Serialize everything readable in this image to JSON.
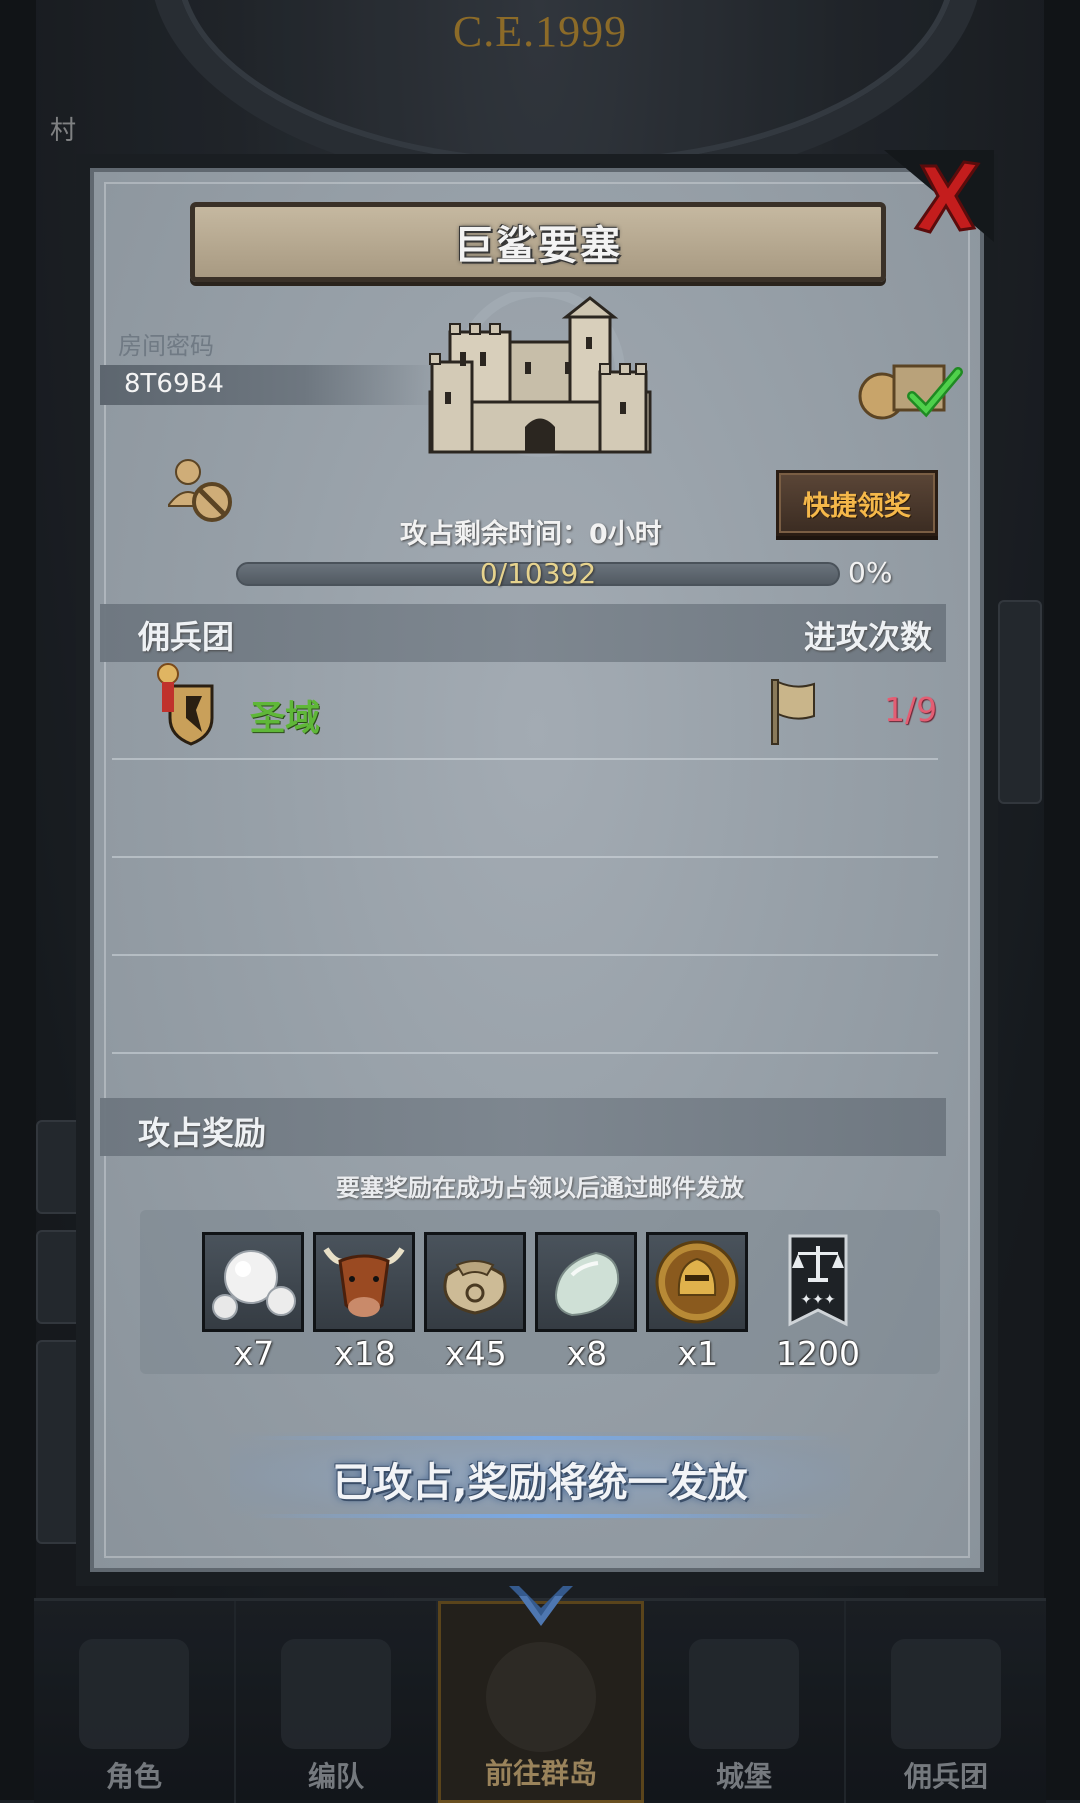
{
  "background": {
    "era_text": "C.E.1999",
    "left_text": "村"
  },
  "bottom_nav": {
    "items": [
      {
        "label": "角色",
        "icon": "knight-icon"
      },
      {
        "label": "编队",
        "icon": "helmet-icon"
      },
      {
        "label": "前往群岛",
        "icon": "globe-icon",
        "active": true
      },
      {
        "label": "城堡",
        "icon": "castle-icon"
      },
      {
        "label": "佣兵团",
        "icon": "mercenary-icon"
      }
    ]
  },
  "dialog": {
    "title": "巨鲨要塞",
    "room_label": "房间密码",
    "room_code": "8T69B4",
    "quick_claim_label": "快捷领奖",
    "remaining_time_label": "攻占剩余时间：0小时",
    "progress": {
      "text": "0/10392",
      "current": 0,
      "total": 10392,
      "percent_text": "0%"
    },
    "mercenary_header": "佣兵团",
    "attack_count_header": "进攻次数",
    "mercenaries": [
      {
        "name": "圣域",
        "attacks": "1/9"
      }
    ],
    "rewards_header": "攻占奖励",
    "rewards_note": "要塞奖励在成功占领以后通过邮件发放",
    "rewards": [
      {
        "icon": "pearl-icon",
        "count": "x7"
      },
      {
        "icon": "bull-icon",
        "count": "x18"
      },
      {
        "icon": "sack-icon",
        "count": "x45"
      },
      {
        "icon": "gem-icon",
        "count": "x8"
      },
      {
        "icon": "knight-medal-icon",
        "count": "x1"
      },
      {
        "icon": "scales-banner-icon",
        "count": "1200"
      }
    ],
    "status_text": "已攻占,奖励将统一发放"
  },
  "colors": {
    "panel": "#97a0a8",
    "mercenary_name": "#5fb738",
    "attack_count": "#e35e73",
    "quick_button_text": "#f5b84a",
    "progress_text": "#e6d38e"
  }
}
